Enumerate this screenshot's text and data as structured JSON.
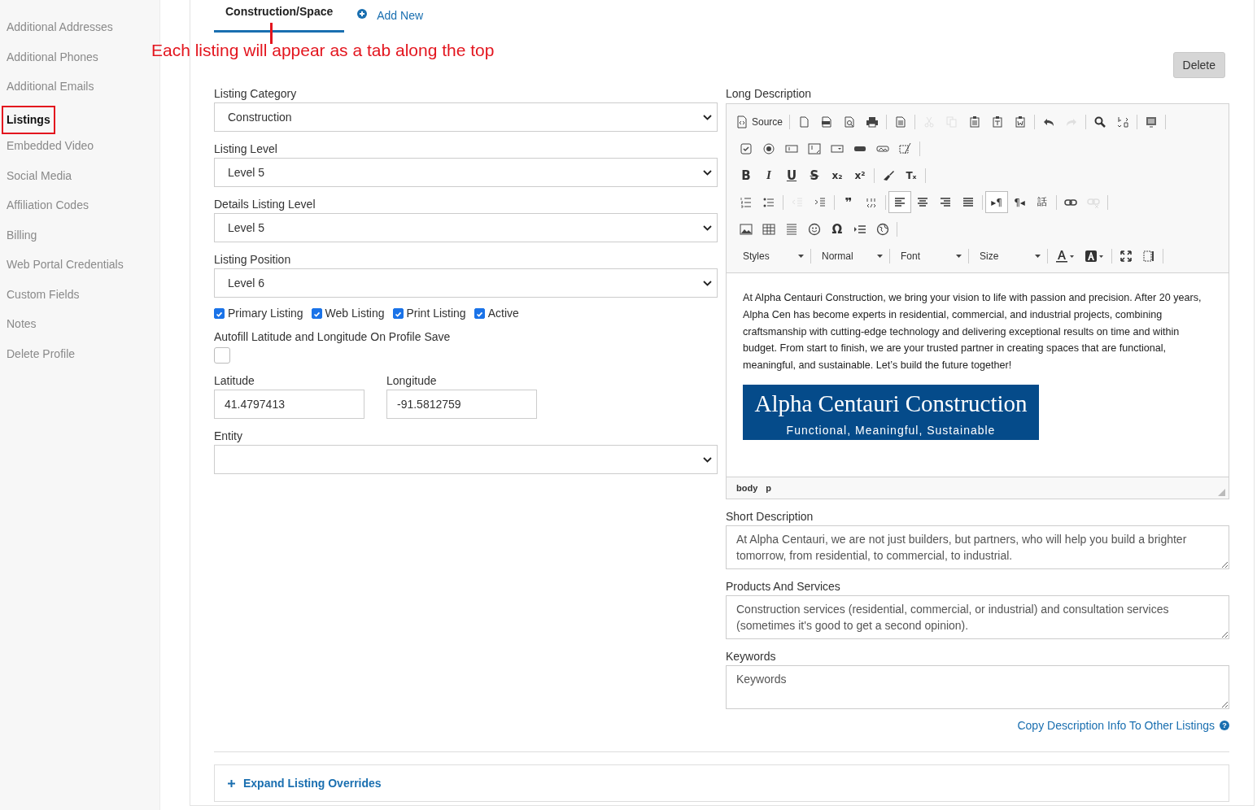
{
  "sidebar": {
    "items": [
      {
        "label": "Additional Addresses",
        "selected": false
      },
      {
        "label": "Additional Phones",
        "selected": false
      },
      {
        "label": "Additional Emails",
        "selected": false
      },
      {
        "label": "Listings",
        "selected": true
      },
      {
        "label": "Embedded Video",
        "selected": false
      },
      {
        "label": "Social Media",
        "selected": false
      },
      {
        "label": "Affiliation Codes",
        "selected": false
      },
      {
        "label": "Billing",
        "selected": false
      },
      {
        "label": "Web Portal Credentials",
        "selected": false
      },
      {
        "label": "Custom Fields",
        "selected": false
      },
      {
        "label": "Notes",
        "selected": false
      },
      {
        "label": "Delete Profile",
        "selected": false
      }
    ]
  },
  "tabs": [
    {
      "label": "Construction/Space",
      "selected": true
    }
  ],
  "add_new": "Add New",
  "annotation": "Each listing will appear as a tab along the top",
  "delete_button": "Delete",
  "selects": [
    {
      "label": "Listing Category",
      "value": "Construction"
    },
    {
      "label": "Listing Level",
      "value": "Level 5"
    },
    {
      "label": "Details Listing Level",
      "value": "Level 5"
    },
    {
      "label": "Listing Position",
      "value": "Level 6"
    }
  ],
  "checkboxes": [
    {
      "label": "Primary Listing",
      "checked": true
    },
    {
      "label": "Web Listing",
      "checked": true
    },
    {
      "label": "Print Listing",
      "checked": true
    },
    {
      "label": "Active",
      "checked": true
    }
  ],
  "autofill": {
    "label": "Autofill Latitude and Longitude On Profile Save",
    "checked": false
  },
  "latitude": {
    "label": "Latitude",
    "value": "41.4797413"
  },
  "longitude": {
    "label": "Longitude",
    "value": "-91.5812759"
  },
  "entity": {
    "label": "Entity"
  },
  "long_description": {
    "label": "Long Description",
    "toolbar": [
      [
        [
          {
            "kind": "source",
            "label": "Source",
            "disabled": false,
            "selected": false
          }
        ],
        [
          {
            "kind": "newpage",
            "disabled": false,
            "selected": false
          },
          {
            "kind": "pdf",
            "disabled": false,
            "selected": false
          },
          {
            "kind": "preview",
            "disabled": false,
            "selected": false
          },
          {
            "kind": "print",
            "disabled": false,
            "selected": false
          }
        ],
        [
          {
            "kind": "templates",
            "disabled": false,
            "selected": false
          }
        ],
        [
          {
            "kind": "cut",
            "disabled": true,
            "selected": false
          },
          {
            "kind": "copy",
            "disabled": true,
            "selected": false
          },
          {
            "kind": "paste",
            "disabled": false,
            "selected": false
          },
          {
            "kind": "pastetext",
            "disabled": false,
            "selected": false
          },
          {
            "kind": "pasteword",
            "disabled": false,
            "selected": false
          }
        ],
        [
          {
            "kind": "undo",
            "disabled": false,
            "selected": false
          },
          {
            "kind": "redo",
            "disabled": true,
            "selected": false
          }
        ],
        [
          {
            "kind": "search",
            "disabled": false,
            "selected": false
          },
          {
            "kind": "replace",
            "disabled": false,
            "selected": false
          }
        ],
        [
          {
            "kind": "selectall",
            "disabled": false,
            "selected": false
          }
        ]
      ],
      [
        [
          {
            "kind": "optionbox",
            "disabled": false,
            "selected": false
          },
          {
            "kind": "bullseye",
            "disabled": false,
            "selected": false
          },
          {
            "kind": "textfield",
            "disabled": false,
            "selected": false
          },
          {
            "kind": "textarea",
            "disabled": false,
            "selected": false
          },
          {
            "kind": "dropdown",
            "disabled": false,
            "selected": false
          },
          {
            "kind": "formbutton",
            "disabled": false,
            "selected": false
          },
          {
            "kind": "imagebutton",
            "disabled": false,
            "selected": false
          },
          {
            "kind": "hiddenfield",
            "disabled": false,
            "selected": false
          }
        ]
      ],
      [
        [
          {
            "kind": "bold",
            "glyph": "B",
            "disabled": false,
            "selected": false
          },
          {
            "kind": "italic",
            "glyph": "I",
            "disabled": false,
            "selected": false
          },
          {
            "kind": "underline",
            "glyph": "U",
            "disabled": false,
            "selected": false
          },
          {
            "kind": "strike",
            "glyph": "S",
            "disabled": false,
            "selected": false
          },
          {
            "kind": "subscript",
            "glyph": "x₂",
            "disabled": false,
            "selected": false
          },
          {
            "kind": "superscript",
            "glyph": "x²",
            "disabled": false,
            "selected": false
          }
        ],
        [
          {
            "kind": "brush",
            "disabled": false,
            "selected": false
          },
          {
            "kind": "removeformat",
            "glyph": "Tₓ",
            "disabled": false,
            "selected": false
          }
        ]
      ],
      [
        [
          {
            "kind": "numlist",
            "disabled": false,
            "selected": false
          },
          {
            "kind": "bulletlist",
            "disabled": false,
            "selected": false
          }
        ],
        [
          {
            "kind": "outdent",
            "disabled": true,
            "selected": false
          },
          {
            "kind": "indent",
            "disabled": false,
            "selected": false
          }
        ],
        [
          {
            "kind": "blockquote",
            "glyph": "❞",
            "disabled": false,
            "selected": false
          },
          {
            "kind": "div",
            "disabled": false,
            "selected": false
          }
        ],
        [
          {
            "kind": "alignleft",
            "disabled": false,
            "selected": true
          },
          {
            "kind": "aligncenter",
            "disabled": false,
            "selected": false
          },
          {
            "kind": "alignright",
            "disabled": false,
            "selected": false
          },
          {
            "kind": "justify",
            "disabled": false,
            "selected": false
          }
        ],
        [
          {
            "kind": "ltr",
            "glyph": "▸¶",
            "disabled": false,
            "selected": true
          },
          {
            "kind": "rtl",
            "glyph": "¶◂",
            "disabled": false,
            "selected": false
          },
          {
            "kind": "language",
            "glyph": "話",
            "disabled": false,
            "selected": false
          }
        ],
        [
          {
            "kind": "link",
            "disabled": false,
            "selected": false
          },
          {
            "kind": "unlink",
            "disabled": true,
            "selected": false
          }
        ]
      ],
      [
        [
          {
            "kind": "image",
            "disabled": false,
            "selected": false
          },
          {
            "kind": "table",
            "disabled": false,
            "selected": false
          },
          {
            "kind": "rule",
            "disabled": false,
            "selected": false
          },
          {
            "kind": "smiley",
            "disabled": false,
            "selected": false
          },
          {
            "kind": "omega",
            "glyph": "Ω",
            "disabled": false,
            "selected": false
          },
          {
            "kind": "pagebreak",
            "disabled": false,
            "selected": false
          },
          {
            "kind": "globe",
            "disabled": false,
            "selected": false
          }
        ]
      ]
    ],
    "combos": [
      "Styles",
      "Normal",
      "Font",
      "Size"
    ],
    "body": "At Alpha Centauri Construction, we bring your vision to life with passion and precision. After 20 years, Alpha Cen has become experts in residential, commercial, and industrial projects, combining craftsmanship with cutting-edge technology and delivering exceptional results on time and within budget. From start to finish, we are your trusted partner in creating spaces that are functional, meaningful, and sustainable. Let’s build the future together!",
    "banner": {
      "title": "Alpha Centauri Construction",
      "subtitle": "Functional, Meaningful, Sustainable"
    },
    "path": [
      "body",
      "p"
    ]
  },
  "textareas": [
    {
      "label": "Short Description",
      "value": "At Alpha Centauri, we are not just builders, but partners, who will help you build a brighter tomorrow, from residential, to commercial, to industrial."
    },
    {
      "label": "Products And Services",
      "value": "Construction services (residential, commercial, or industrial) and consultation services (sometimes it's good to get a second opinion)."
    },
    {
      "label": "Keywords",
      "placeholder": "Keywords"
    }
  ],
  "copy_link": "Copy Description Info To Other Listings",
  "help_glyph": "?",
  "expand": "Expand Listing Overrides"
}
